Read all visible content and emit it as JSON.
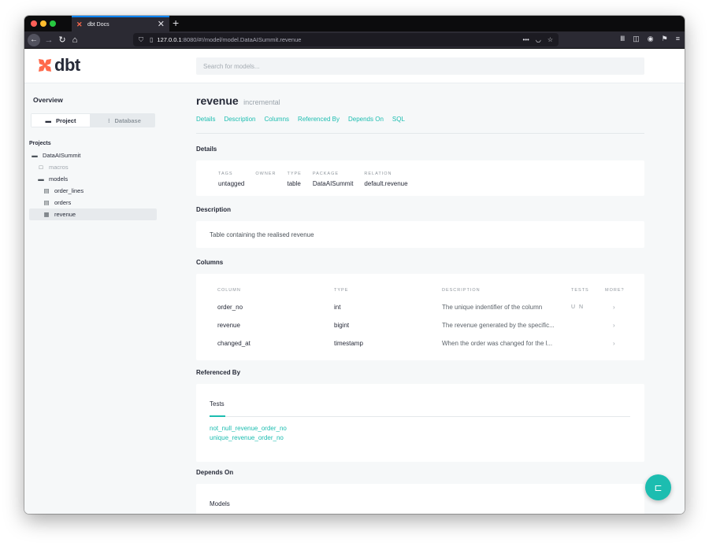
{
  "browser": {
    "tab_title": "dbt Docs",
    "tab_close": "✕",
    "new_tab": "+",
    "url_host": "127.0.0.1",
    "url_path": ":8080/#!/model/model.DataAISummit.revenue",
    "url_actions": "•••",
    "icons": [
      "back-icon",
      "forward-icon",
      "reload-icon",
      "home-icon",
      "shield-icon",
      "page-icon",
      "pocket-icon",
      "star-icon",
      "library-icon",
      "sidebar-icon",
      "account-icon",
      "extensions-icon",
      "menu-icon"
    ]
  },
  "header": {
    "logo_text": "dbt",
    "search_placeholder": "Search for models..."
  },
  "sidebar": {
    "overview": "Overview",
    "switch": {
      "project": "Project",
      "database": "Database"
    },
    "projects_label": "Projects",
    "tree": [
      {
        "label": "DataAISummit",
        "icon": "folder-open-icon",
        "indent": 1,
        "state": "normal"
      },
      {
        "label": "macros",
        "icon": "folder-icon",
        "indent": 2,
        "state": "muted"
      },
      {
        "label": "models",
        "icon": "folder-open-icon",
        "indent": 2,
        "state": "normal"
      },
      {
        "label": "order_lines",
        "icon": "file-icon",
        "indent": 3,
        "state": "normal"
      },
      {
        "label": "orders",
        "icon": "file-icon",
        "indent": 3,
        "state": "normal"
      },
      {
        "label": "revenue",
        "icon": "file-filled-icon",
        "indent": 3,
        "state": "active"
      }
    ]
  },
  "model": {
    "name": "revenue",
    "materialization": "incremental",
    "section_tabs": [
      "Details",
      "Description",
      "Columns",
      "Referenced By",
      "Depends On",
      "SQL"
    ]
  },
  "details": {
    "heading": "Details",
    "fields": [
      {
        "label": "TAGS",
        "value": "untagged"
      },
      {
        "label": "OWNER",
        "value": ""
      },
      {
        "label": "TYPE",
        "value": "table"
      },
      {
        "label": "PACKAGE",
        "value": "DataAISummit"
      },
      {
        "label": "RELATION",
        "value": "default.revenue"
      }
    ]
  },
  "description": {
    "heading": "Description",
    "text": "Table containing the realised revenue"
  },
  "columns": {
    "heading": "Columns",
    "headers": [
      "COLUMN",
      "TYPE",
      "DESCRIPTION",
      "TESTS",
      "MORE?"
    ],
    "rows": [
      {
        "column": "order_no",
        "type": "int",
        "description": "The unique indentifier of the column",
        "tests": "U N",
        "more": "›"
      },
      {
        "column": "revenue",
        "type": "bigint",
        "description": "The revenue generated by the specific...",
        "tests": "",
        "more": "›"
      },
      {
        "column": "changed_at",
        "type": "timestamp",
        "description": "When the order was changed for the l...",
        "tests": "",
        "more": "›"
      }
    ]
  },
  "referenced_by": {
    "heading": "Referenced By",
    "subheading": "Tests",
    "links": [
      "not_null_revenue_order_no",
      "unique_revenue_order_no"
    ]
  },
  "depends_on": {
    "heading": "Depends On",
    "subheading": "Models"
  },
  "colors": {
    "accent": "#1cbdb0",
    "brand": "#ff694b",
    "text": "#262a38"
  }
}
